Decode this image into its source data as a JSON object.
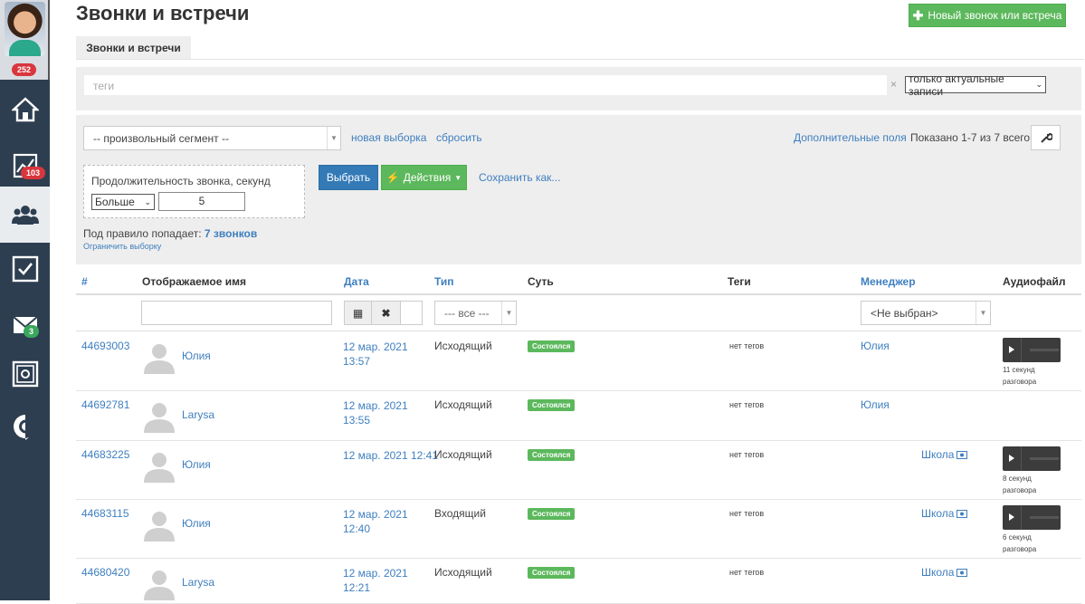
{
  "sidebar": {
    "profile_badge": "252",
    "items": [
      {
        "name": "home-icon"
      },
      {
        "name": "chart-icon",
        "badge": "103"
      },
      {
        "name": "users-icon",
        "active": true
      },
      {
        "name": "checkbox-icon"
      },
      {
        "name": "mail-icon",
        "badge": "3"
      },
      {
        "name": "safe-icon"
      },
      {
        "name": "chat-icon"
      }
    ]
  },
  "header": {
    "title": "Звонки и встречи",
    "new_button": "Новый звонок или встреча",
    "tab": "Звонки и встречи"
  },
  "tags": {
    "placeholder": "теги",
    "clear": "×",
    "filter_select": "только актуальные записи"
  },
  "segment": {
    "select": "-- произвольный сегмент --",
    "new_selection": "новая выборка",
    "reset": "сбросить",
    "extra_fields": "Дополнительные поля",
    "shown": "Показано 1-7 из 7 всего.",
    "rule_title": "Продолжительность звонка, секунд",
    "rule_op": "Больше",
    "rule_value": "5",
    "select_btn": "Выбрать",
    "actions_btn": "Действия",
    "save_as": "Сохранить как...",
    "match_prefix": "Под правило попадает:",
    "match_count": "7 звонков",
    "limit": "Ограничить выборку"
  },
  "table": {
    "headers": {
      "id": "#",
      "name": "Отображаемое имя",
      "date": "Дата",
      "type": "Тип",
      "essence": "Суть",
      "tags": "Теги",
      "manager": "Менеджер",
      "audio": "Аудиофайл"
    },
    "filters": {
      "type": "--- все ---",
      "manager": "<Не выбран>"
    },
    "rows": [
      {
        "id": "44693003",
        "name": "Юлия",
        "date1": "12 мар. 2021",
        "date2": "13:57",
        "type": "Исходящий",
        "status": "Состоялся",
        "tags": "нет тегов",
        "manager": "Юлия",
        "audio_cap1": "11 секунд",
        "audio_cap2": "разговора"
      },
      {
        "id": "44692781",
        "name": "Larysa",
        "date1": "12 мар. 2021",
        "date2": "13:55",
        "type": "Исходящий",
        "status": "Состоялся",
        "tags": "нет тегов",
        "manager": "Юлия"
      },
      {
        "id": "44683225",
        "name": "Юлия",
        "date1": "12 мар. 2021 12:41",
        "date2": "",
        "type": "Исходящий",
        "status": "Состоялся",
        "tags": "нет тегов",
        "manager_right": "Школа",
        "audio_cap1": "8 секунд",
        "audio_cap2": "разговора"
      },
      {
        "id": "44683115",
        "name": "Юлия",
        "date1": "12 мар. 2021",
        "date2": "12:40",
        "type": "Входящий",
        "status": "Состоялся",
        "tags": "нет тегов",
        "manager_right": "Школа",
        "audio_cap1": "6 секунд",
        "audio_cap2": "разговора"
      },
      {
        "id": "44680420",
        "name": "Larysa",
        "date1": "12 мар. 2021",
        "date2": "12:21",
        "type": "Исходящий",
        "status": "Состоялся",
        "tags": "нет тегов",
        "manager_right": "Школа"
      }
    ]
  }
}
